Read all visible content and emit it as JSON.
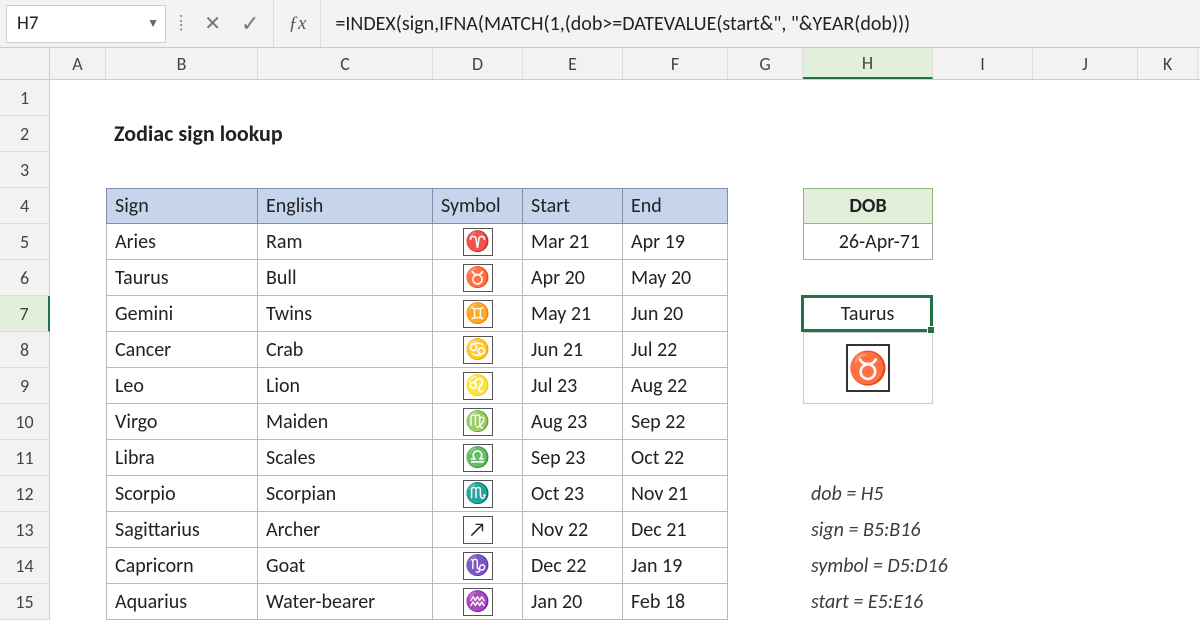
{
  "name_box": "H7",
  "formula": "=INDEX(sign,IFNA(MATCH(1,(dob>=DATEVALUE(start&\", \"&YEAR(dob)))",
  "columns": [
    "A",
    "B",
    "C",
    "D",
    "E",
    "F",
    "G",
    "H",
    "I",
    "J",
    "K"
  ],
  "active_col": "H",
  "active_row": 7,
  "row_numbers": [
    1,
    2,
    3,
    4,
    5,
    6,
    7,
    8,
    9,
    10,
    11,
    12,
    13,
    14,
    15
  ],
  "title": "Zodiac sign lookup",
  "headers": {
    "sign": "Sign",
    "english": "English",
    "symbol": "Symbol",
    "start": "Start",
    "end": "End"
  },
  "table": [
    {
      "sign": "Aries",
      "english": "Ram",
      "symbol": "♈",
      "start": "Mar 21",
      "end": "Apr 19"
    },
    {
      "sign": "Taurus",
      "english": "Bull",
      "symbol": "♉",
      "start": "Apr 20",
      "end": "May 20"
    },
    {
      "sign": "Gemini",
      "english": "Twins",
      "symbol": "♊",
      "start": "May 21",
      "end": "Jun 20"
    },
    {
      "sign": "Cancer",
      "english": "Crab",
      "symbol": "♋",
      "start": "Jun 21",
      "end": "Jul 22"
    },
    {
      "sign": "Leo",
      "english": "Lion",
      "symbol": "♌",
      "start": "Jul 23",
      "end": "Aug 22"
    },
    {
      "sign": "Virgo",
      "english": "Maiden",
      "symbol": "♍",
      "start": "Aug 23",
      "end": "Sep 22"
    },
    {
      "sign": "Libra",
      "english": "Scales",
      "symbol": "♎",
      "start": "Sep 23",
      "end": "Oct 22"
    },
    {
      "sign": "Scorpio",
      "english": "Scorpian",
      "symbol": "♏",
      "start": "Oct 23",
      "end": "Nov 21"
    },
    {
      "sign": "Sagittarius",
      "english": "Archer",
      "symbol": "↗",
      "start": "Nov 22",
      "end": "Dec 21"
    },
    {
      "sign": "Capricorn",
      "english": "Goat",
      "symbol": "♑",
      "start": "Dec 22",
      "end": "Jan 19"
    },
    {
      "sign": "Aquarius",
      "english": "Water-bearer",
      "symbol": "♒",
      "start": "Jan 20",
      "end": "Feb 18"
    }
  ],
  "dob": {
    "label": "DOB",
    "value": "26-Apr-71"
  },
  "result_sign": "Taurus",
  "result_symbol": "♉",
  "notes": [
    "dob = H5",
    "sign = B5:B16",
    "symbol = D5:D16",
    "start = E5:E16"
  ]
}
